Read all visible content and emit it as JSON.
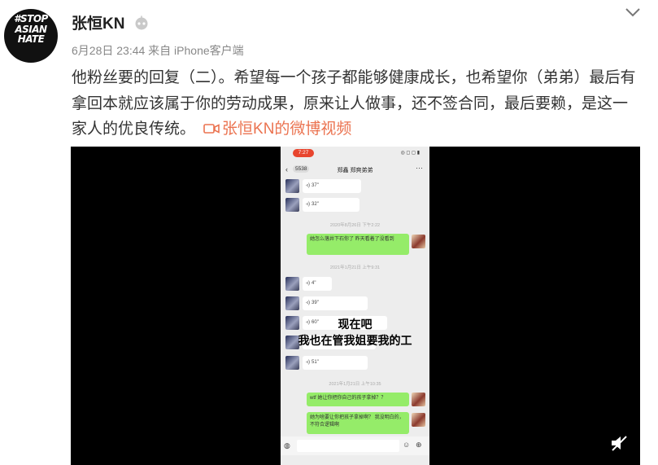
{
  "avatar": {
    "logo_text": "#STOP\nASIAN\nHATE"
  },
  "user": {
    "name": "张恒KN",
    "badge_icon": "robot-badge-icon"
  },
  "meta": {
    "text": "6月28日 23:44 来自 iPhone客户端"
  },
  "post": {
    "body": "他粉丝要的回复（二）。希望每一个孩子都能够健康成长，也希望你（弟弟）最后有拿回本就应该属于你的劳动成果，原来让人做事，还不签合同，最后要赖，是这一家人的优良传统。",
    "video_link": "张恒KN的微博视频",
    "link_color": "#eb7350"
  },
  "phone": {
    "status_time": "7:27",
    "status_right": "◎ ◻ ◻ ▮",
    "nav": {
      "back": "‹",
      "count": "5538",
      "title": "郑鑫 郑爽弟弟",
      "more": "···"
    },
    "messages": [
      {
        "side": "left",
        "text": "37\""
      },
      {
        "side": "left",
        "text": "32\""
      },
      {
        "type": "time",
        "text": "2020年8月26日 下午2:22"
      },
      {
        "side": "right",
        "text": "她怎么落井下石你了 昨天看着了没看到"
      },
      {
        "type": "time",
        "text": "2021年1月21日 上午9:31"
      },
      {
        "side": "left",
        "text": "4\""
      },
      {
        "side": "left",
        "text": "39\""
      },
      {
        "side": "left",
        "text": "60\""
      },
      {
        "side": "left",
        "text": ""
      },
      {
        "side": "left",
        "text": "51\""
      },
      {
        "type": "time",
        "text": "2021年1月21日 上午10:35"
      },
      {
        "side": "right",
        "text": "wtf 她让你把你自己的孩子拿掉？？"
      },
      {
        "side": "right",
        "text": "她为啥要让你把孩子拿掉啊？ 我没明白的，不符合逻辑啊"
      }
    ],
    "caption_line1": "现在吧",
    "caption_line2": "我也在管我姐要我的工",
    "bubble_green": "#95ec69"
  },
  "controls": {
    "mute_icon": "mute-speaker-icon"
  }
}
